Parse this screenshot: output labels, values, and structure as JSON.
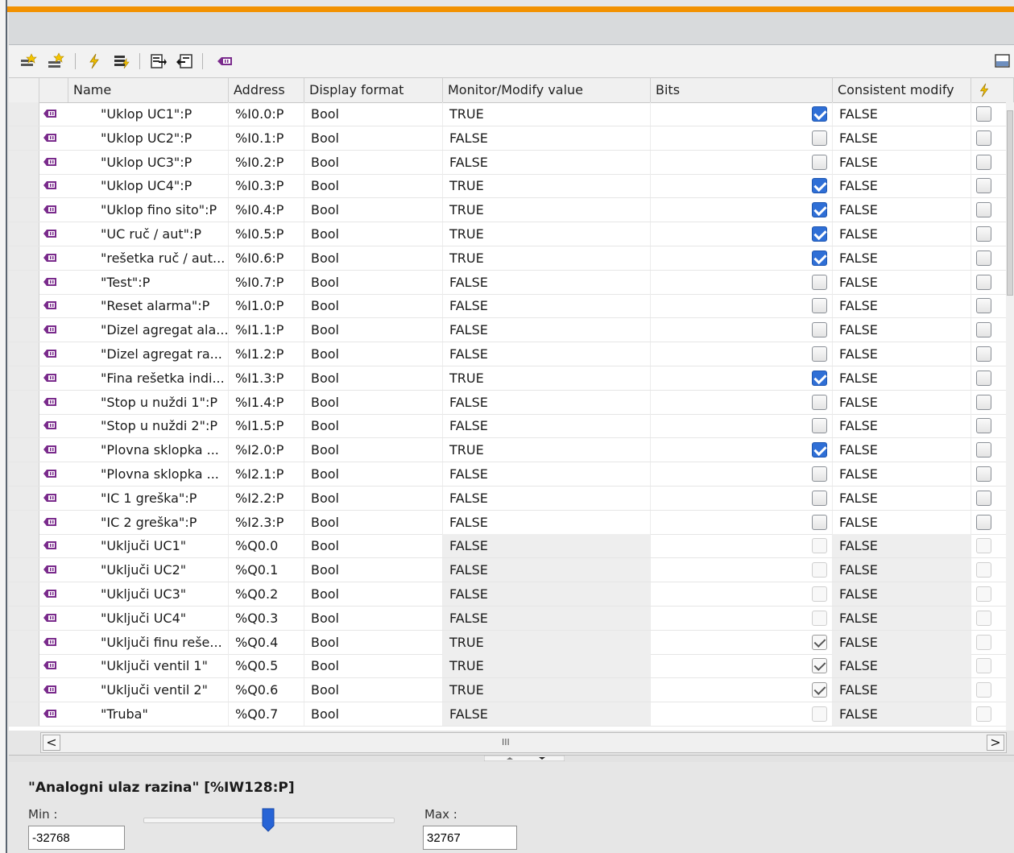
{
  "columns": {
    "name": "Name",
    "address": "Address",
    "display_format": "Display format",
    "monitor_value": "Monitor/Modify value",
    "bits": "Bits",
    "consistent_modify": "Consistent modify"
  },
  "toolbar_icons": [
    "insert-row-icon",
    "add-row-icon",
    "modify-now-icon",
    "modify-with-trigger-icon",
    "monitor-all-icon",
    "monitor-now-icon",
    "tag-icon",
    "panel-layout-icon"
  ],
  "rows": [
    {
      "name": "\"Uklop UC1\":P",
      "address": "%I0.0:P",
      "format": "Bool",
      "value": "TRUE",
      "bit": true,
      "consistent": "FALSE",
      "editable": true
    },
    {
      "name": "\"Uklop UC2\":P",
      "address": "%I0.1:P",
      "format": "Bool",
      "value": "FALSE",
      "bit": false,
      "consistent": "FALSE",
      "editable": true
    },
    {
      "name": "\"Uklop UC3\":P",
      "address": "%I0.2:P",
      "format": "Bool",
      "value": "FALSE",
      "bit": false,
      "consistent": "FALSE",
      "editable": true
    },
    {
      "name": "\"Uklop UC4\":P",
      "address": "%I0.3:P",
      "format": "Bool",
      "value": "TRUE",
      "bit": true,
      "consistent": "FALSE",
      "editable": true
    },
    {
      "name": "\"Uklop fino sito\":P",
      "address": "%I0.4:P",
      "format": "Bool",
      "value": "TRUE",
      "bit": true,
      "consistent": "FALSE",
      "editable": true
    },
    {
      "name": "\"UC ruč / aut\":P",
      "address": "%I0.5:P",
      "format": "Bool",
      "value": "TRUE",
      "bit": true,
      "consistent": "FALSE",
      "editable": true
    },
    {
      "name": "\"rešetka ruč / aut...",
      "address": "%I0.6:P",
      "format": "Bool",
      "value": "TRUE",
      "bit": true,
      "consistent": "FALSE",
      "editable": true
    },
    {
      "name": "\"Test\":P",
      "address": "%I0.7:P",
      "format": "Bool",
      "value": "FALSE",
      "bit": false,
      "consistent": "FALSE",
      "editable": true
    },
    {
      "name": "\"Reset alarma\":P",
      "address": "%I1.0:P",
      "format": "Bool",
      "value": "FALSE",
      "bit": false,
      "consistent": "FALSE",
      "editable": true
    },
    {
      "name": "\"Dizel agregat ala...",
      "address": "%I1.1:P",
      "format": "Bool",
      "value": "FALSE",
      "bit": false,
      "consistent": "FALSE",
      "editable": true
    },
    {
      "name": "\"Dizel agregat ra...",
      "address": "%I1.2:P",
      "format": "Bool",
      "value": "FALSE",
      "bit": false,
      "consistent": "FALSE",
      "editable": true
    },
    {
      "name": "\"Fina rešetka indi...",
      "address": "%I1.3:P",
      "format": "Bool",
      "value": "TRUE",
      "bit": true,
      "consistent": "FALSE",
      "editable": true
    },
    {
      "name": "\"Stop u nuždi 1\":P",
      "address": "%I1.4:P",
      "format": "Bool",
      "value": "FALSE",
      "bit": false,
      "consistent": "FALSE",
      "editable": true
    },
    {
      "name": "\"Stop u nuždi 2\":P",
      "address": "%I1.5:P",
      "format": "Bool",
      "value": "FALSE",
      "bit": false,
      "consistent": "FALSE",
      "editable": true
    },
    {
      "name": "\"Plovna sklopka ...",
      "address": "%I2.0:P",
      "format": "Bool",
      "value": "TRUE",
      "bit": true,
      "consistent": "FALSE",
      "editable": true
    },
    {
      "name": "\"Plovna sklopka ...",
      "address": "%I2.1:P",
      "format": "Bool",
      "value": "FALSE",
      "bit": false,
      "consistent": "FALSE",
      "editable": true
    },
    {
      "name": "\"IC 1 greška\":P",
      "address": "%I2.2:P",
      "format": "Bool",
      "value": "FALSE",
      "bit": false,
      "consistent": "FALSE",
      "editable": true
    },
    {
      "name": "\"IC 2 greška\":P",
      "address": "%I2.3:P",
      "format": "Bool",
      "value": "FALSE",
      "bit": false,
      "consistent": "FALSE",
      "editable": true
    },
    {
      "name": "\"Uključi UC1\"",
      "address": "%Q0.0",
      "format": "Bool",
      "value": "FALSE",
      "bit": false,
      "consistent": "FALSE",
      "editable": false
    },
    {
      "name": "\"Uključi UC2\"",
      "address": "%Q0.1",
      "format": "Bool",
      "value": "FALSE",
      "bit": false,
      "consistent": "FALSE",
      "editable": false
    },
    {
      "name": "\"Uključi UC3\"",
      "address": "%Q0.2",
      "format": "Bool",
      "value": "FALSE",
      "bit": false,
      "consistent": "FALSE",
      "editable": false
    },
    {
      "name": "\"Uključi UC4\"",
      "address": "%Q0.3",
      "format": "Bool",
      "value": "FALSE",
      "bit": false,
      "consistent": "FALSE",
      "editable": false
    },
    {
      "name": "\"Uključi finu reše...",
      "address": "%Q0.4",
      "format": "Bool",
      "value": "TRUE",
      "bit": true,
      "consistent": "FALSE",
      "editable": false
    },
    {
      "name": "\"Uključi ventil 1\"",
      "address": "%Q0.5",
      "format": "Bool",
      "value": "TRUE",
      "bit": true,
      "consistent": "FALSE",
      "editable": false
    },
    {
      "name": "\"Uključi ventil 2\"",
      "address": "%Q0.6",
      "format": "Bool",
      "value": "TRUE",
      "bit": true,
      "consistent": "FALSE",
      "editable": false
    },
    {
      "name": "\"Truba\"",
      "address": "%Q0.7",
      "format": "Bool",
      "value": "FALSE",
      "bit": false,
      "consistent": "FALSE",
      "editable": false
    }
  ],
  "scrollbar": {
    "grip": "III"
  },
  "detail": {
    "title": "\"Analogni ulaz razina\" [%IW128:P]",
    "min_label": "Min :",
    "min_value": "-32768",
    "max_label": "Max :",
    "max_value": "32767",
    "slider_fraction": 0.5
  },
  "colors": {
    "accent": "#f29100",
    "check": "#2f6fd6",
    "tag_icon": "#7a2b8c"
  }
}
